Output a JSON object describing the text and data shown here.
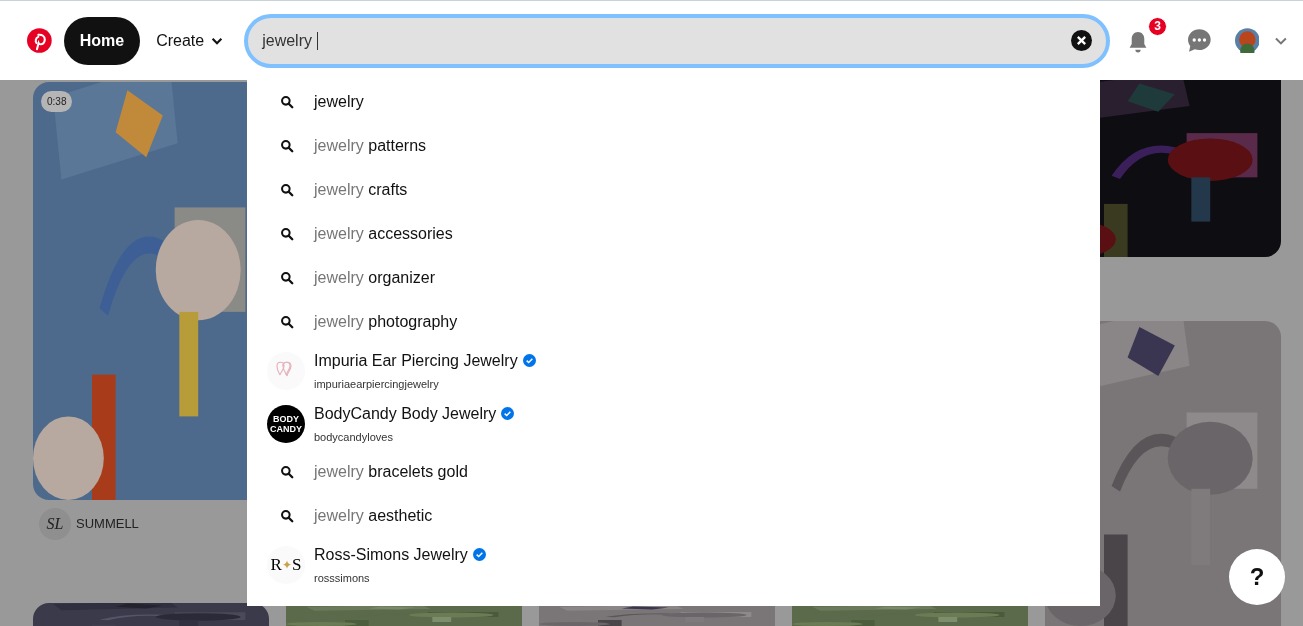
{
  "header": {
    "home": {
      "label": "Home",
      "selected": true
    },
    "create": {
      "label": "Create"
    },
    "search": {
      "value": "jewelry"
    },
    "notifications": {
      "count": "3"
    }
  },
  "suggestions": [
    {
      "kind": "query",
      "text": "jewelry"
    },
    {
      "kind": "query",
      "muted": "jewelry",
      "text": "patterns"
    },
    {
      "kind": "query",
      "muted": "jewelry",
      "text": "crafts"
    },
    {
      "kind": "query",
      "muted": "jewelry",
      "text": "accessories"
    },
    {
      "kind": "query",
      "muted": "jewelry",
      "text": "organizer"
    },
    {
      "kind": "query",
      "muted": "jewelry",
      "text": "photography"
    },
    {
      "kind": "account",
      "name": "Impuria Ear Piercing Jewelry",
      "handle": "impuriaearpiercingjewelry",
      "verified": true,
      "logo": {
        "kind": "hearts"
      }
    },
    {
      "kind": "account",
      "name": "BodyCandy Body Jewelry",
      "handle": "bodycandyloves",
      "verified": true,
      "logo": {
        "kind": "badge",
        "lines": [
          "BODY",
          "CANDY"
        ]
      }
    },
    {
      "kind": "query",
      "muted": "jewelry",
      "text": "bracelets gold"
    },
    {
      "kind": "query",
      "muted": "jewelry",
      "text": "aesthetic"
    },
    {
      "kind": "account",
      "name": "Ross-Simons Jewelry",
      "handle": "rosssimons",
      "verified": true,
      "logo": {
        "kind": "monogram",
        "left": "R",
        "mark": "✦",
        "right": "S"
      }
    }
  ],
  "pins": {
    "video_duration": "0:38",
    "creator": {
      "initials": "SL",
      "name": "SUMMELL"
    }
  },
  "help": {
    "label": "?"
  }
}
